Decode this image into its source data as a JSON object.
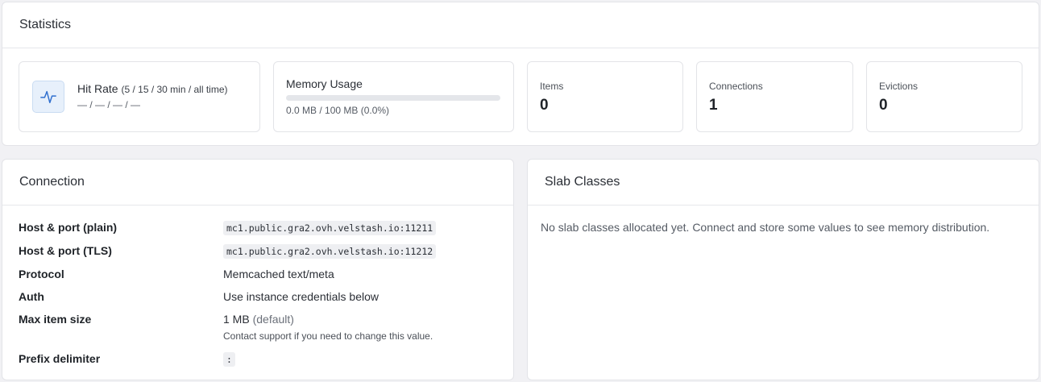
{
  "statistics": {
    "title": "Statistics",
    "hit_rate": {
      "label": "Hit Rate",
      "windows": "(5 / 15 / 30 min / all time)",
      "values": "— / — / — / —",
      "icon": "activity-icon"
    },
    "memory": {
      "label": "Memory Usage",
      "usage_text": "0.0 MB / 100 MB (0.0%)",
      "percent": 0.0
    },
    "items": {
      "label": "Items",
      "value": "0"
    },
    "connections": {
      "label": "Connections",
      "value": "1"
    },
    "evictions": {
      "label": "Evictions",
      "value": "0"
    },
    "accent_color": "#2f7de1"
  },
  "connection": {
    "title": "Connection",
    "rows": [
      {
        "key": "Host & port (plain)",
        "value": "mc1.public.gra2.ovh.velstash.io:11211"
      },
      {
        "key": "Host & port (TLS)",
        "value": "mc1.public.gra2.ovh.velstash.io:11212"
      },
      {
        "key": "Protocol",
        "value": "Memcached text/meta"
      },
      {
        "key": "Auth",
        "value": "Use instance credentials below"
      },
      {
        "key": "Max item size",
        "value": "1 MB",
        "note": "(default)",
        "help": "Contact support if you need to change this value."
      },
      {
        "key": "Prefix delimiter",
        "value": ":"
      }
    ]
  },
  "slab_classes": {
    "title": "Slab Classes",
    "empty_message": "No slab classes allocated yet. Connect and store some values to see memory distribution."
  }
}
